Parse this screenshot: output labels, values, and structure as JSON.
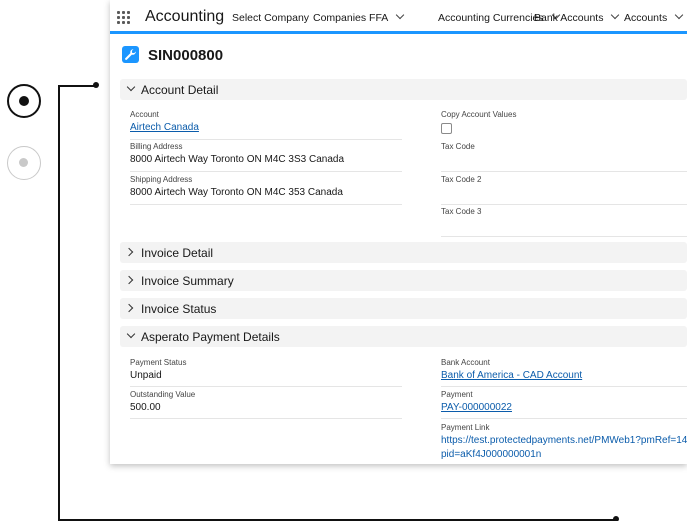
{
  "nav": {
    "app_name": "Accounting",
    "items": [
      {
        "label": "Select Company",
        "has_menu": false
      },
      {
        "label": "Companies FFA",
        "has_menu": true
      },
      {
        "label": "Accounting Currencies",
        "has_menu": true
      },
      {
        "label": "Bank Accounts",
        "has_menu": true
      },
      {
        "label": "Accounts",
        "has_menu": true
      }
    ]
  },
  "record": {
    "icon": "wrench-icon",
    "title": "SIN000800"
  },
  "sections": {
    "account_detail": {
      "title": "Account Detail",
      "expanded": true,
      "fields": {
        "account": {
          "label": "Account",
          "value": "Airtech Canada"
        },
        "billing_address": {
          "label": "Billing Address",
          "value": "8000 Airtech Way Toronto ON M4C 3S3 Canada"
        },
        "shipping_address": {
          "label": "Shipping Address",
          "value": "8000 Airtech Way Toronto ON M4C 353 Canada"
        },
        "copy_account_values": {
          "label": "Copy Account Values",
          "checked": false
        },
        "tax_code": {
          "label": "Tax Code",
          "value": ""
        },
        "tax_code_2": {
          "label": "Tax Code 2",
          "value": ""
        },
        "tax_code_3": {
          "label": "Tax Code 3",
          "value": ""
        }
      }
    },
    "invoice_detail": {
      "title": "Invoice Detail",
      "expanded": false
    },
    "invoice_summary": {
      "title": "Invoice Summary",
      "expanded": false
    },
    "invoice_status": {
      "title": "Invoice Status",
      "expanded": false
    },
    "asperato": {
      "title": "Asperato Payment Details",
      "expanded": true,
      "fields": {
        "payment_status": {
          "label": "Payment Status",
          "value": "Unpaid"
        },
        "outstanding_value": {
          "label": "Outstanding Value",
          "value": "500.00"
        },
        "bank_account": {
          "label": "Bank Account",
          "value": "Bank of America - CAD Account"
        },
        "payment": {
          "label": "Payment",
          "value": "PAY-000000022"
        },
        "payment_link": {
          "label": "Payment Link",
          "line1": "https://test.protectedpayments.net/PMWeb1?pmRef=14",
          "line2": "pid=aKf4J000000001n"
        }
      }
    }
  },
  "stepper": {
    "active_step": 1,
    "steps": 2
  },
  "colors": {
    "accent": "#1b96ff",
    "link": "#0b5cab",
    "section_bg": "#f3f3f3"
  }
}
